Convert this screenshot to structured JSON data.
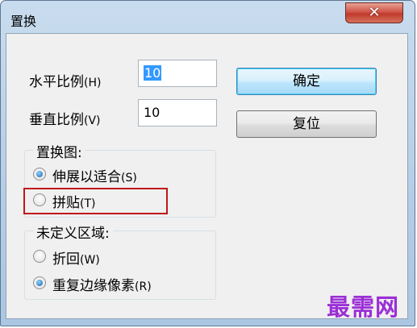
{
  "window": {
    "title": "置换",
    "close_glyph": "✕"
  },
  "scale": {
    "horizontal_label": "水平比例",
    "horizontal_key": "(H)",
    "horizontal_value": "10",
    "vertical_label": "垂直比例",
    "vertical_key": "(V)",
    "vertical_value": "10"
  },
  "buttons": {
    "ok": "确定",
    "reset": "复位"
  },
  "displacement_map": {
    "title": "置换图:",
    "options": [
      {
        "label": "伸展以适合",
        "key": "(S)",
        "checked": true
      },
      {
        "label": "拼贴",
        "key": "(T)",
        "checked": false
      }
    ]
  },
  "undefined_areas": {
    "title": "未定义区域:",
    "options": [
      {
        "label": "折回",
        "key": "(W)",
        "checked": false
      },
      {
        "label": "重复边缘像素",
        "key": "(R)",
        "checked": true
      }
    ]
  },
  "watermark": "最需网",
  "colors": {
    "highlight": "#c0171d",
    "selection": "#3399ff",
    "watermark": "#9b2fd6"
  }
}
